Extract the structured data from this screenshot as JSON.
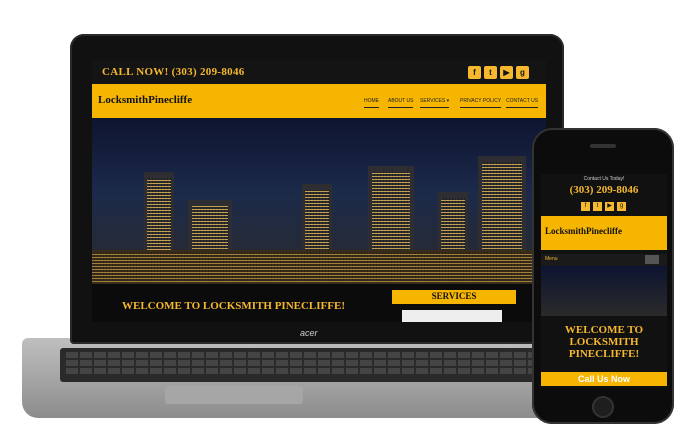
{
  "laptop": {
    "call_now": "CALL NOW! (303) 209-8046",
    "logo": "LocksmithPinecliffe",
    "nav": [
      "HOME",
      "ABOUT US",
      "SERVICES ▾",
      "PRIVACY POLICY",
      "CONTACT US"
    ],
    "welcome": "WELCOME TO LOCKSMITH PINECLIFFE!",
    "services": "SERVICES",
    "brand": "acer",
    "social_icons": [
      "facebook-icon",
      "twitter-icon",
      "youtube-icon",
      "google-plus-icon"
    ]
  },
  "phone": {
    "contact": "Contact Us Today!",
    "phone_number": "(303) 209-8046",
    "logo": "LocksmithPinecliffe",
    "menu": "Menu",
    "welcome_line1": "WELCOME TO",
    "welcome_line2": "LOCKSMITH",
    "welcome_line3": "PINECLIFFE!",
    "call_button": "Call Us Now"
  },
  "colors": {
    "accent": "#f5b500",
    "accent_text": "#f5b82e",
    "dark": "#0b0b0b"
  }
}
